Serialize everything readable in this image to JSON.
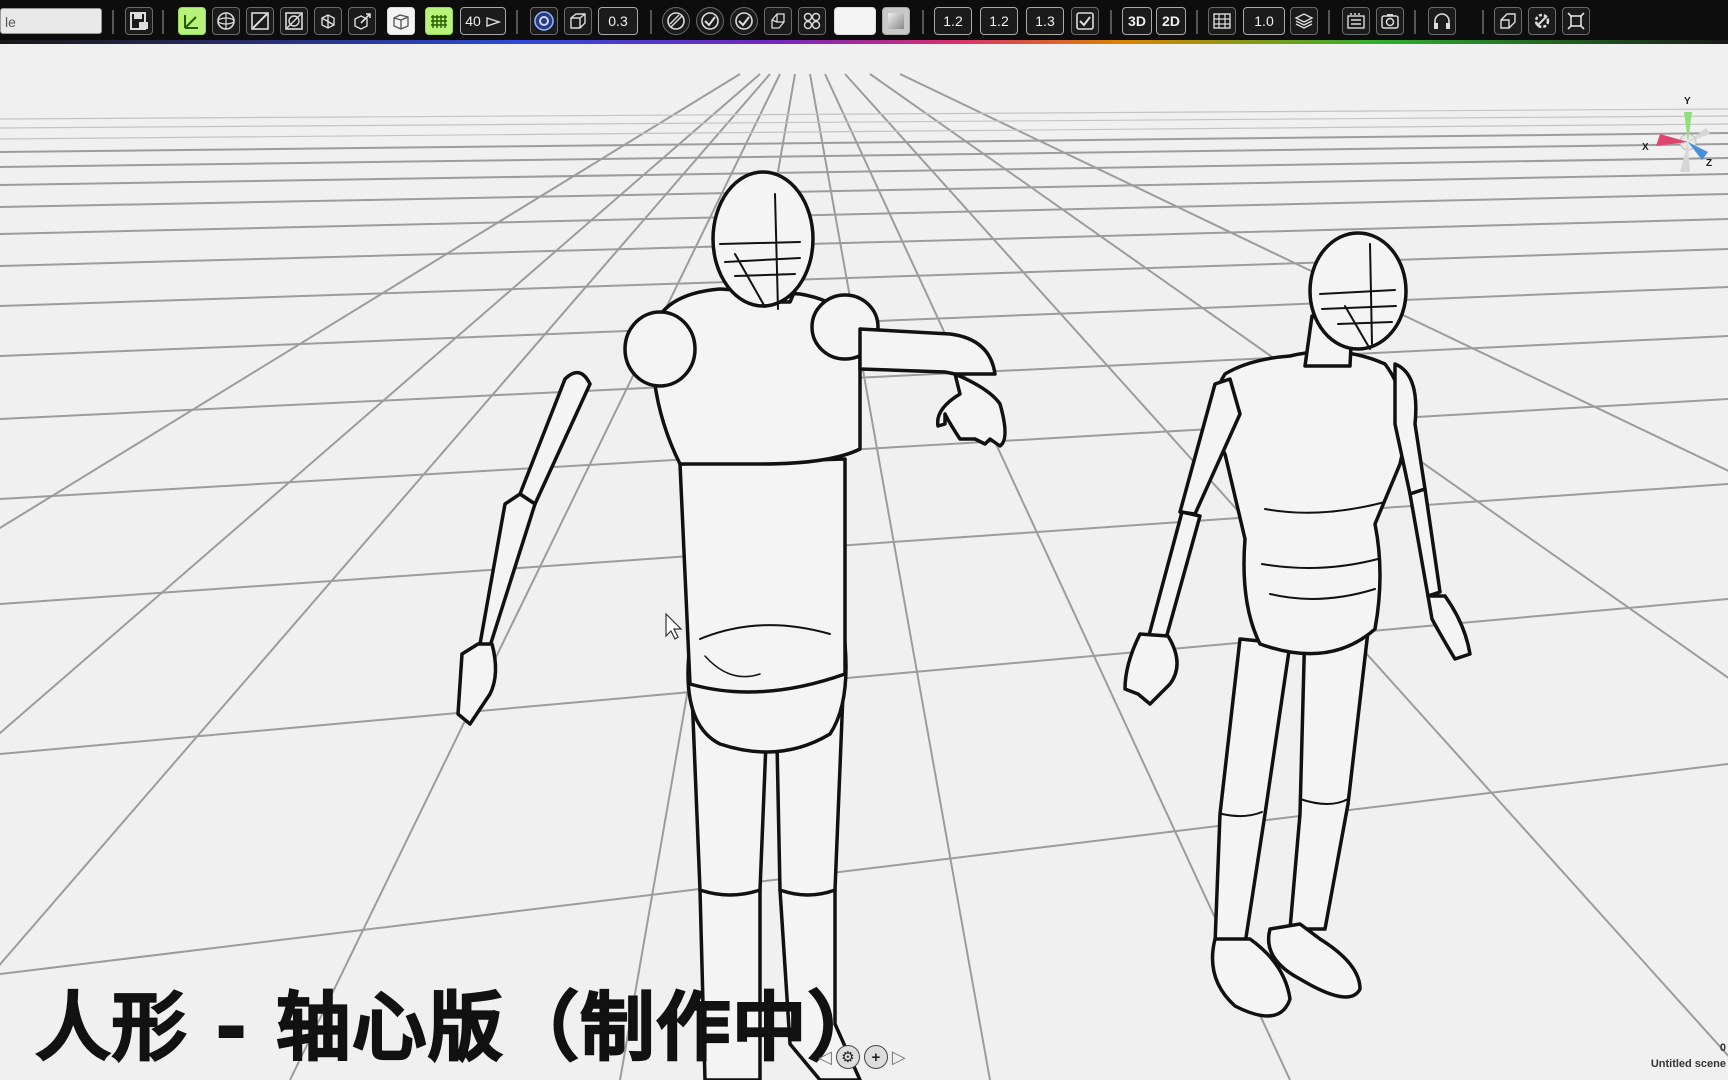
{
  "toolbar": {
    "file_field_text": "le",
    "number_fields": {
      "camera_fov": "40",
      "outline_width": "0.3",
      "scale_a": "1.2",
      "scale_b": "1.2",
      "scale_c": "1.3",
      "light_value": "1.0"
    },
    "view_modes": {
      "mode_3d": "3D",
      "mode_2d": "2D"
    }
  },
  "viewport": {
    "axis_gizmo": {
      "x_label": "X",
      "y_label": "Y",
      "z_label": "Z"
    },
    "caption": "人形 - 轴心版（制作中）",
    "status": {
      "object_count": "0",
      "scene_name": "Untitled scene"
    }
  },
  "colors": {
    "toolbar_bg": "#0d0d0d",
    "active_tool_green": "#b7f27a",
    "viewport_bg": "#f0f0f0",
    "grid_line": "#9a9a9a",
    "figure_outline": "#111111",
    "axis_x": "#e0456e",
    "axis_y": "#8ee07a",
    "axis_z": "#4a8fd9"
  },
  "icons": [
    "save-scene-icon",
    "select-tool-icon",
    "sphere-object-icon",
    "slope-icon",
    "frame-icon",
    "cube-transform-icon",
    "cube-arrow-icon",
    "box-wire-icon",
    "grid-floor-icon",
    "camera-icon",
    "target-circle-icon",
    "cube-icon",
    "paint-icon",
    "check-circle-icon",
    "check-icon",
    "cylinder-icon",
    "layout-icon",
    "material-icon",
    "checkbox-icon",
    "layers-icon",
    "film-icon",
    "snapshot-icon",
    "headphones-icon",
    "code-icon",
    "settings-icon",
    "fit-view-icon"
  ]
}
